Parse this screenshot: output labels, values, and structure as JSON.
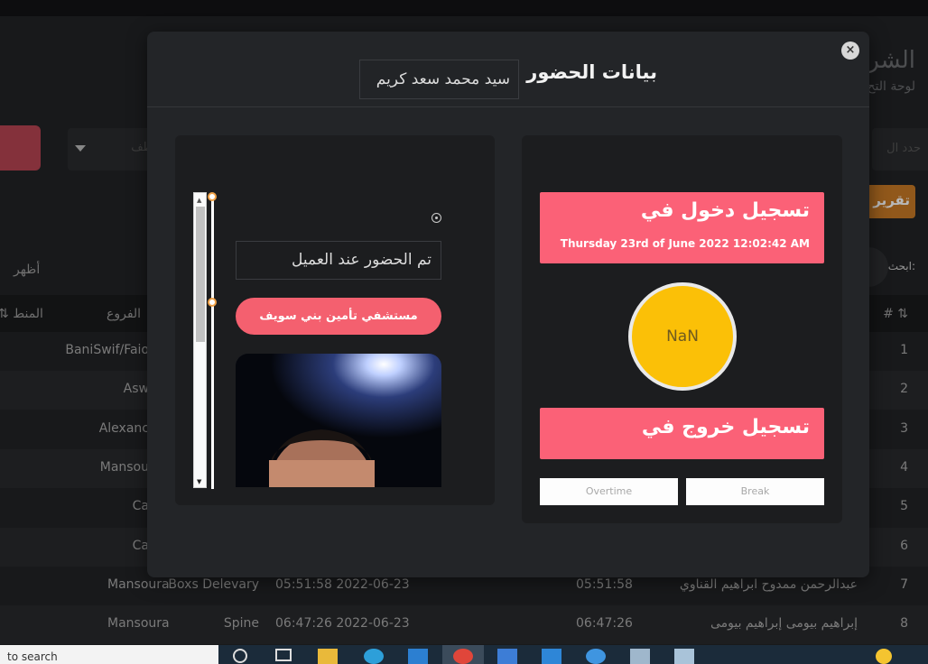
{
  "background": {
    "page_title": "الشرك",
    "page_subtitle": "لوحة التح",
    "select_placeholder": "ظف",
    "right_input_placeholder": "حدد ال",
    "report_button": "تقرير",
    "show_label": "أظهر",
    "search_label": "ابحث:",
    "table": {
      "headers": {
        "index": "# ⇅",
        "branches": "الفروع",
        "regions": "⇅ المنط"
      },
      "rows": [
        {
          "num": "1",
          "region": "",
          "branch": "BaniSwif/Faio",
          "login": "",
          "time": "",
          "name": ""
        },
        {
          "num": "2",
          "region": "",
          "branch": "Asw",
          "login": "",
          "time": "",
          "name": ""
        },
        {
          "num": "3",
          "region": "",
          "branch": "Alexanc",
          "login": "",
          "time": "",
          "name": ""
        },
        {
          "num": "4",
          "region": "",
          "branch": "Mansou",
          "login": "",
          "time": "",
          "name": ""
        },
        {
          "num": "5",
          "region": "",
          "branch": "Ca",
          "login": "",
          "time": "",
          "name": ""
        },
        {
          "num": "6",
          "region": "",
          "branch": "Ca",
          "login": "",
          "time": "",
          "name": ""
        },
        {
          "num": "7",
          "region": "Mansoura",
          "branch": "Boxs Delevary",
          "login": "05:51:58 2022-06-23",
          "time": "05:51:58",
          "name": "عبدالرحمن ممدوح ابراهيم القناوي"
        },
        {
          "num": "8",
          "region": "Mansoura",
          "branch": "Spine",
          "login": "06:47:26 2022-06-23",
          "time": "06:47:26",
          "name": "إبراهيم بيومى إبراهيم بيومى"
        }
      ]
    }
  },
  "modal": {
    "title": "بيانات الحضور",
    "employee_name": "سيد محمد سعد كريم",
    "close_icon": "×",
    "left": {
      "note": "تم الحضور عند العميل",
      "branch": "مستشفي تأمين بني سويف"
    },
    "right": {
      "check_in_title": "تسجيل دخول في",
      "check_in_time": "Thursday 23rd of June 2022 12:02:42 AM",
      "duration": "NaN",
      "check_out_title": "تسجيل خروج في",
      "overtime_label": "Overtime",
      "break_label": "Break"
    }
  },
  "taskbar": {
    "search_text": "to search"
  },
  "colors": {
    "accent_pink": "#fb6177",
    "accent_yellow": "#fbc007",
    "report_orange": "#c97a26"
  }
}
